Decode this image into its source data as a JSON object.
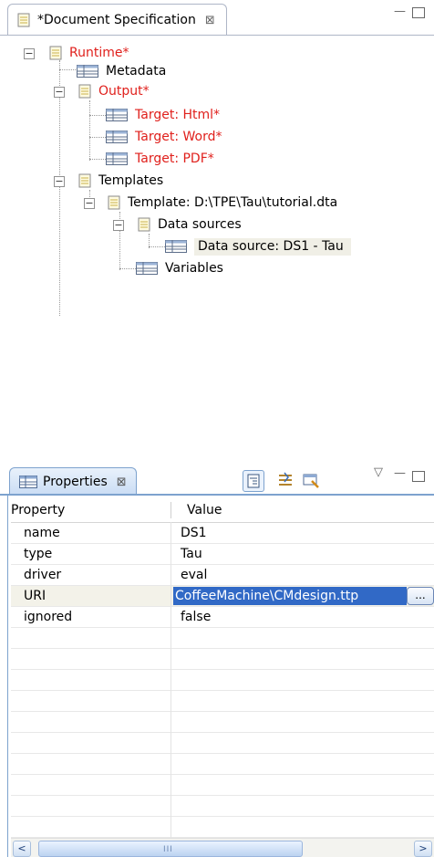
{
  "top_view": {
    "tab_title": "*Document Specification",
    "tab_close": "⊠",
    "minimize": "—",
    "maximize": "□"
  },
  "tree": {
    "runtime": "Runtime*",
    "metadata": "Metadata",
    "output": "Output*",
    "target_html": "Target: Html*",
    "target_word": "Target: Word*",
    "target_pdf": "Target: PDF*",
    "templates": "Templates",
    "template": "Template: D:\\TPE\\Tau\\tutorial.dta",
    "data_sources": "Data sources",
    "data_source": "Data source: DS1 - Tau",
    "variables": "Variables",
    "expander_minus": "−"
  },
  "properties_view": {
    "tab_title": "Properties",
    "tab_close": "⊠",
    "view_menu": "▽",
    "minimize": "—",
    "maximize": "□",
    "columns": {
      "property": "Property",
      "value": "Value"
    },
    "rows": [
      {
        "property": "name",
        "value": "DS1"
      },
      {
        "property": "type",
        "value": "Tau"
      },
      {
        "property": "driver",
        "value": "eval"
      },
      {
        "property": "URI",
        "value": "CoffeeMachine\\CMdesign.ttp"
      },
      {
        "property": "ignored",
        "value": "false"
      }
    ],
    "browse_button": "...",
    "scroll_left": "<",
    "scroll_right": ">",
    "scroll_grip": "III"
  },
  "colors": {
    "modified_red": "#e0201c",
    "selection_blue": "#3169c6",
    "tab_blue": "#7da2ce"
  }
}
